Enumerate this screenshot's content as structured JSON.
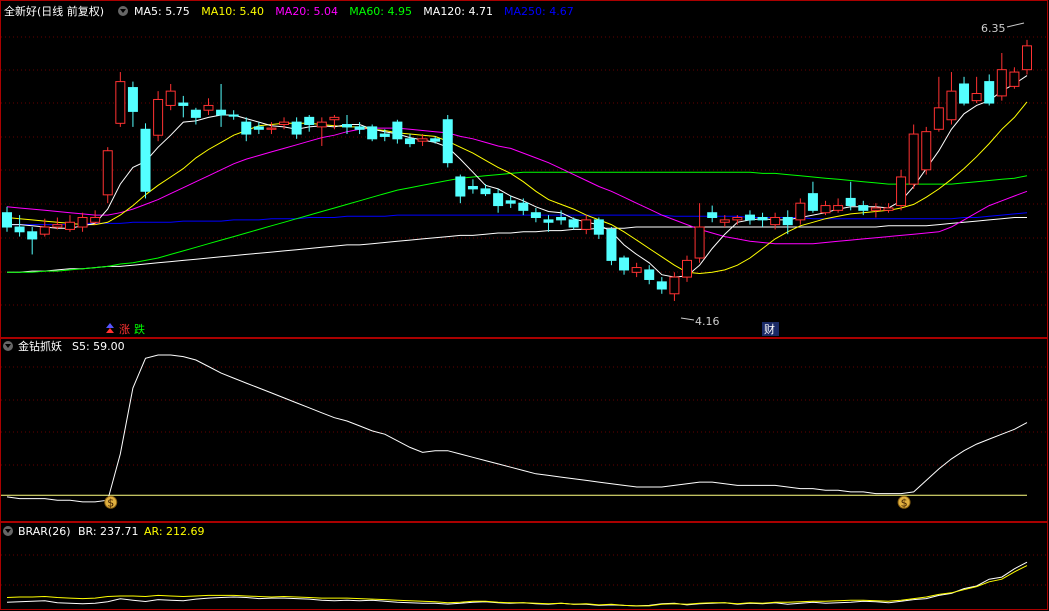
{
  "main_panel": {
    "title": "全新好(日线 前复权)",
    "indicators": [
      {
        "label": "MA5: 5.75",
        "color": "#FFFFFF"
      },
      {
        "label": "MA10: 5.40",
        "color": "#FFFF00"
      },
      {
        "label": "MA20: 5.04",
        "color": "#FF00FF"
      },
      {
        "label": "MA60: 4.95",
        "color": "#00FF00"
      },
      {
        "label": "MA120: 4.71",
        "color": "#FFFFFF"
      },
      {
        "label": "MA250: 4.67",
        "color": "#0000FF"
      }
    ],
    "high_label": "6.35",
    "low_label": "4.16",
    "marker_up": "涨",
    "marker_down": "跌",
    "marker_fin": "财"
  },
  "sub1": {
    "title": "金钻抓妖",
    "value_label": "S5: 59.00",
    "signal_glyph": "$"
  },
  "sub2": {
    "title": "BRAR(26)",
    "br_label": "BR: 237.71",
    "ar_label": "AR: 212.69"
  },
  "colors": {
    "up": "#FF3232",
    "down": "#54FFFF",
    "bg": "#000000",
    "border": "#AA0000",
    "grid": "#660000",
    "ma5": "#FFFFFF",
    "ma10": "#FFFF00",
    "ma20": "#FF00FF",
    "ma60": "#00FF00",
    "ma120": "#FFFFFF",
    "ma250": "#0000FF",
    "s5": "#FFFFFF",
    "baseline": "#FFFF80",
    "br": "#FFFFFF",
    "ar": "#FFFF00"
  },
  "chart_data": [
    {
      "type": "candlestick",
      "x_count": 82,
      "ylim": [
        4.0,
        6.5
      ],
      "candles": [
        [
          4.9,
          4.78,
          4.95,
          4.74
        ],
        [
          4.78,
          4.74,
          4.88,
          4.7
        ],
        [
          4.74,
          4.68,
          4.78,
          4.55
        ],
        [
          4.72,
          4.78,
          4.85,
          4.7
        ],
        [
          4.78,
          4.8,
          4.86,
          4.76
        ],
        [
          4.76,
          4.82,
          4.88,
          4.74
        ],
        [
          4.78,
          4.86,
          4.9,
          4.74
        ],
        [
          4.82,
          4.86,
          4.92,
          4.8
        ],
        [
          5.05,
          5.42,
          5.45,
          4.98
        ],
        [
          5.65,
          6.0,
          6.08,
          5.62
        ],
        [
          5.95,
          5.75,
          6.0,
          5.62
        ],
        [
          5.6,
          5.08,
          5.65,
          5.02
        ],
        [
          5.55,
          5.85,
          5.92,
          5.5
        ],
        [
          5.8,
          5.92,
          5.98,
          5.76
        ],
        [
          5.82,
          5.8,
          5.88,
          5.7
        ],
        [
          5.76,
          5.7,
          5.78,
          5.64
        ],
        [
          5.76,
          5.8,
          5.86,
          5.72
        ],
        [
          5.76,
          5.72,
          5.98,
          5.62
        ],
        [
          5.72,
          5.71,
          5.76,
          5.68
        ],
        [
          5.66,
          5.56,
          5.7,
          5.5
        ],
        [
          5.62,
          5.6,
          5.66,
          5.56
        ],
        [
          5.6,
          5.61,
          5.66,
          5.56
        ],
        [
          5.64,
          5.66,
          5.7,
          5.6
        ],
        [
          5.66,
          5.56,
          5.7,
          5.52
        ],
        [
          5.7,
          5.64,
          5.72,
          5.58
        ],
        [
          5.62,
          5.66,
          5.7,
          5.46
        ],
        [
          5.68,
          5.7,
          5.72,
          5.6
        ],
        [
          5.64,
          5.62,
          5.72,
          5.56
        ],
        [
          5.62,
          5.6,
          5.66,
          5.56
        ],
        [
          5.62,
          5.52,
          5.64,
          5.5
        ],
        [
          5.56,
          5.54,
          5.6,
          5.5
        ],
        [
          5.66,
          5.52,
          5.68,
          5.48
        ],
        [
          5.52,
          5.48,
          5.56,
          5.45
        ],
        [
          5.5,
          5.52,
          5.56,
          5.46
        ],
        [
          5.52,
          5.5,
          5.54,
          5.48
        ],
        [
          5.68,
          5.32,
          5.72,
          5.28
        ],
        [
          5.2,
          5.04,
          5.22,
          4.98
        ],
        [
          5.12,
          5.1,
          5.18,
          5.06
        ],
        [
          5.1,
          5.06,
          5.14,
          5.04
        ],
        [
          5.06,
          4.96,
          5.1,
          4.9
        ],
        [
          5.0,
          4.98,
          5.04,
          4.94
        ],
        [
          4.98,
          4.92,
          5.02,
          4.88
        ],
        [
          4.9,
          4.86,
          4.94,
          4.82
        ],
        [
          4.84,
          4.82,
          4.88,
          4.74
        ],
        [
          4.86,
          4.84,
          4.92,
          4.8
        ],
        [
          4.84,
          4.78,
          4.86,
          4.76
        ],
        [
          4.76,
          4.84,
          4.88,
          4.72
        ],
        [
          4.84,
          4.72,
          4.86,
          4.68
        ],
        [
          4.76,
          4.5,
          4.78,
          4.46
        ],
        [
          4.52,
          4.42,
          4.54,
          4.38
        ],
        [
          4.4,
          4.44,
          4.48,
          4.36
        ],
        [
          4.42,
          4.34,
          4.46,
          4.3
        ],
        [
          4.32,
          4.26,
          4.36,
          4.22
        ],
        [
          4.22,
          4.36,
          4.4,
          4.16
        ],
        [
          4.36,
          4.5,
          4.54,
          4.32
        ],
        [
          4.52,
          4.78,
          4.98,
          4.48
        ],
        [
          4.9,
          4.86,
          4.96,
          4.82
        ],
        [
          4.82,
          4.84,
          4.88,
          4.78
        ],
        [
          4.84,
          4.86,
          4.88,
          4.8
        ],
        [
          4.88,
          4.84,
          4.92,
          4.8
        ],
        [
          4.86,
          4.84,
          4.9,
          4.78
        ],
        [
          4.8,
          4.86,
          4.9,
          4.76
        ],
        [
          4.86,
          4.8,
          4.92,
          4.72
        ],
        [
          4.84,
          4.98,
          5.02,
          4.8
        ],
        [
          5.06,
          4.92,
          5.16,
          4.9
        ],
        [
          4.9,
          4.96,
          5.0,
          4.88
        ],
        [
          4.92,
          4.96,
          5.02,
          4.9
        ],
        [
          5.02,
          4.96,
          5.16,
          4.92
        ],
        [
          4.96,
          4.92,
          5.0,
          4.88
        ],
        [
          4.92,
          4.94,
          4.98,
          4.86
        ],
        [
          4.92,
          4.94,
          4.98,
          4.9
        ],
        [
          4.96,
          5.2,
          5.26,
          4.92
        ],
        [
          5.14,
          5.56,
          5.64,
          5.1
        ],
        [
          5.26,
          5.58,
          5.62,
          5.22
        ],
        [
          5.6,
          5.78,
          6.04,
          5.58
        ],
        [
          5.68,
          5.92,
          6.08,
          5.64
        ],
        [
          5.98,
          5.82,
          6.04,
          5.8
        ],
        [
          5.84,
          5.9,
          6.04,
          5.82
        ],
        [
          6.0,
          5.82,
          6.06,
          5.8
        ],
        [
          5.88,
          6.1,
          6.24,
          5.84
        ],
        [
          5.96,
          6.08,
          6.12,
          5.94
        ],
        [
          6.1,
          6.3,
          6.35,
          6.06
        ]
      ],
      "ma5": [
        4.8,
        4.8,
        4.79,
        4.78,
        4.77,
        4.77,
        4.79,
        4.81,
        4.93,
        5.14,
        5.28,
        5.33,
        5.45,
        5.55,
        5.66,
        5.67,
        5.7,
        5.72,
        5.72,
        5.69,
        5.66,
        5.63,
        5.62,
        5.6,
        5.62,
        5.63,
        5.62,
        5.64,
        5.64,
        5.6,
        5.58,
        5.56,
        5.53,
        5.51,
        5.49,
        5.45,
        5.35,
        5.24,
        5.13,
        5.1,
        5.04,
        5.0,
        4.95,
        4.91,
        4.9,
        4.85,
        4.82,
        4.8,
        4.74,
        4.63,
        4.55,
        4.48,
        4.38,
        4.36,
        4.37,
        4.46,
        4.6,
        4.72,
        4.82,
        4.84,
        4.85,
        4.84,
        4.84,
        4.86,
        4.88,
        4.9,
        4.93,
        4.95,
        4.95,
        4.95,
        4.94,
        5.0,
        5.12,
        5.27,
        5.42,
        5.6,
        5.73,
        5.8,
        5.84,
        5.92,
        5.98,
        6.05
      ],
      "ma10": [
        4.86,
        4.85,
        4.84,
        4.83,
        4.82,
        4.81,
        4.8,
        4.8,
        4.82,
        4.88,
        4.96,
        5.05,
        5.13,
        5.2,
        5.27,
        5.36,
        5.43,
        5.49,
        5.55,
        5.59,
        5.63,
        5.64,
        5.65,
        5.65,
        5.65,
        5.64,
        5.63,
        5.62,
        5.62,
        5.6,
        5.59,
        5.57,
        5.56,
        5.55,
        5.54,
        5.5,
        5.45,
        5.4,
        5.34,
        5.28,
        5.23,
        5.16,
        5.08,
        5.01,
        4.97,
        4.93,
        4.88,
        4.84,
        4.8,
        4.74,
        4.67,
        4.6,
        4.53,
        4.46,
        4.4,
        4.39,
        4.4,
        4.42,
        4.46,
        4.52,
        4.6,
        4.68,
        4.74,
        4.79,
        4.82,
        4.85,
        4.87,
        4.89,
        4.9,
        4.91,
        4.92,
        4.94,
        4.97,
        5.03,
        5.1,
        5.18,
        5.27,
        5.37,
        5.48,
        5.6,
        5.7,
        5.83
      ],
      "ma20": [
        4.95,
        4.94,
        4.93,
        4.92,
        4.91,
        4.9,
        4.89,
        4.88,
        4.88,
        4.9,
        4.93,
        4.97,
        5.01,
        5.06,
        5.11,
        5.16,
        5.21,
        5.26,
        5.31,
        5.35,
        5.38,
        5.41,
        5.44,
        5.47,
        5.5,
        5.53,
        5.55,
        5.58,
        5.6,
        5.61,
        5.61,
        5.61,
        5.6,
        5.59,
        5.58,
        5.57,
        5.54,
        5.52,
        5.49,
        5.46,
        5.44,
        5.4,
        5.36,
        5.32,
        5.27,
        5.22,
        5.17,
        5.12,
        5.08,
        5.03,
        4.98,
        4.93,
        4.88,
        4.84,
        4.8,
        4.76,
        4.73,
        4.7,
        4.68,
        4.66,
        4.65,
        4.64,
        4.64,
        4.64,
        4.64,
        4.65,
        4.66,
        4.67,
        4.68,
        4.69,
        4.7,
        4.71,
        4.72,
        4.73,
        4.74,
        4.78,
        4.84,
        4.9,
        4.96,
        5.0,
        5.04,
        5.08
      ],
      "ma60": [
        4.4,
        4.4,
        4.4,
        4.41,
        4.41,
        4.42,
        4.43,
        4.44,
        4.45,
        4.47,
        4.48,
        4.5,
        4.52,
        4.55,
        4.58,
        4.61,
        4.64,
        4.67,
        4.7,
        4.73,
        4.76,
        4.79,
        4.82,
        4.85,
        4.88,
        4.91,
        4.94,
        4.97,
        5.0,
        5.03,
        5.06,
        5.09,
        5.11,
        5.13,
        5.15,
        5.17,
        5.19,
        5.2,
        5.21,
        5.22,
        5.23,
        5.24,
        5.24,
        5.24,
        5.24,
        5.24,
        5.24,
        5.24,
        5.24,
        5.24,
        5.24,
        5.24,
        5.24,
        5.24,
        5.24,
        5.24,
        5.24,
        5.24,
        5.24,
        5.24,
        5.23,
        5.23,
        5.22,
        5.21,
        5.2,
        5.19,
        5.18,
        5.17,
        5.16,
        5.15,
        5.14,
        5.14,
        5.14,
        5.14,
        5.14,
        5.14,
        5.15,
        5.16,
        5.17,
        5.18,
        5.19,
        5.21
      ],
      "ma120": [
        4.4,
        4.4,
        4.41,
        4.41,
        4.42,
        4.43,
        4.43,
        4.44,
        4.45,
        4.45,
        4.46,
        4.47,
        4.48,
        4.49,
        4.5,
        4.51,
        4.52,
        4.53,
        4.54,
        4.55,
        4.56,
        4.57,
        4.58,
        4.59,
        4.6,
        4.61,
        4.62,
        4.63,
        4.63,
        4.64,
        4.65,
        4.66,
        4.67,
        4.68,
        4.69,
        4.7,
        4.71,
        4.71,
        4.72,
        4.73,
        4.73,
        4.74,
        4.74,
        4.75,
        4.75,
        4.76,
        4.76,
        4.77,
        4.77,
        4.77,
        4.78,
        4.78,
        4.78,
        4.78,
        4.78,
        4.78,
        4.78,
        4.78,
        4.78,
        4.78,
        4.78,
        4.78,
        4.78,
        4.78,
        4.78,
        4.78,
        4.78,
        4.78,
        4.78,
        4.78,
        4.79,
        4.79,
        4.79,
        4.79,
        4.8,
        4.81,
        4.82,
        4.83,
        4.84,
        4.85,
        4.86,
        4.86
      ],
      "ma250": [
        4.8,
        4.8,
        4.8,
        4.8,
        4.8,
        4.8,
        4.81,
        4.81,
        4.81,
        4.81,
        4.82,
        4.82,
        4.82,
        4.82,
        4.83,
        4.83,
        4.83,
        4.83,
        4.84,
        4.84,
        4.84,
        4.85,
        4.85,
        4.85,
        4.86,
        4.86,
        4.86,
        4.87,
        4.87,
        4.87,
        4.87,
        4.88,
        4.88,
        4.88,
        4.88,
        4.88,
        4.88,
        4.88,
        4.88,
        4.88,
        4.88,
        4.88,
        4.88,
        4.88,
        4.88,
        4.88,
        4.88,
        4.88,
        4.88,
        4.88,
        4.88,
        4.88,
        4.88,
        4.87,
        4.87,
        4.87,
        4.87,
        4.87,
        4.87,
        4.86,
        4.86,
        4.86,
        4.86,
        4.86,
        4.85,
        4.85,
        4.85,
        4.85,
        4.85,
        4.85,
        4.85,
        4.85,
        4.85,
        4.85,
        4.85,
        4.85,
        4.86,
        4.86,
        4.87,
        4.88,
        4.89,
        4.9
      ]
    },
    {
      "type": "line",
      "ylim": [
        0,
        100
      ],
      "s5": [
        14,
        13,
        13,
        13,
        12,
        12,
        11,
        11,
        12,
        40,
        80,
        98,
        100,
        100,
        99,
        97,
        93,
        89,
        86,
        83,
        80,
        77,
        74,
        71,
        68,
        65,
        62,
        60,
        57,
        54,
        52,
        48,
        44,
        41,
        42,
        42,
        40,
        38,
        36,
        34,
        32,
        30,
        28,
        27,
        26,
        25,
        24,
        23,
        22,
        21,
        20,
        20,
        20,
        21,
        22,
        23,
        23,
        22,
        21,
        21,
        21,
        21,
        20,
        19,
        19,
        18,
        18,
        17,
        17,
        16,
        16,
        16,
        17,
        24,
        31,
        37,
        42,
        46,
        49,
        52,
        55,
        59
      ],
      "baseline": 15,
      "signals": [
        8,
        71
      ]
    },
    {
      "type": "line",
      "ylim": [
        0,
        260
      ],
      "br": [
        22,
        24,
        26,
        28,
        20,
        18,
        16,
        18,
        24,
        35,
        30,
        25,
        32,
        30,
        28,
        34,
        38,
        40,
        42,
        40,
        36,
        38,
        38,
        36,
        34,
        30,
        28,
        30,
        28,
        30,
        26,
        22,
        20,
        18,
        18,
        15,
        18,
        22,
        24,
        20,
        18,
        20,
        16,
        14,
        18,
        14,
        14,
        10,
        12,
        10,
        8,
        10,
        16,
        18,
        12,
        16,
        18,
        20,
        14,
        18,
        16,
        20,
        14,
        18,
        22,
        18,
        20,
        22,
        26,
        24,
        20,
        26,
        32,
        36,
        48,
        56,
        74,
        84,
        110,
        118,
        150,
        175
      ],
      "ar": [
        40,
        42,
        42,
        44,
        40,
        38,
        36,
        38,
        44,
        46,
        46,
        44,
        48,
        46,
        44,
        46,
        48,
        48,
        48,
        46,
        44,
        42,
        44,
        42,
        40,
        38,
        38,
        38,
        36,
        34,
        32,
        30,
        28,
        26,
        24,
        20,
        22,
        26,
        26,
        22,
        20,
        20,
        18,
        16,
        18,
        14,
        16,
        12,
        14,
        10,
        8,
        8,
        14,
        16,
        14,
        18,
        20,
        20,
        16,
        20,
        18,
        22,
        22,
        24,
        26,
        26,
        28,
        30,
        30,
        28,
        26,
        30,
        36,
        42,
        52,
        58,
        70,
        82,
        100,
        110,
        138,
        162
      ]
    }
  ]
}
